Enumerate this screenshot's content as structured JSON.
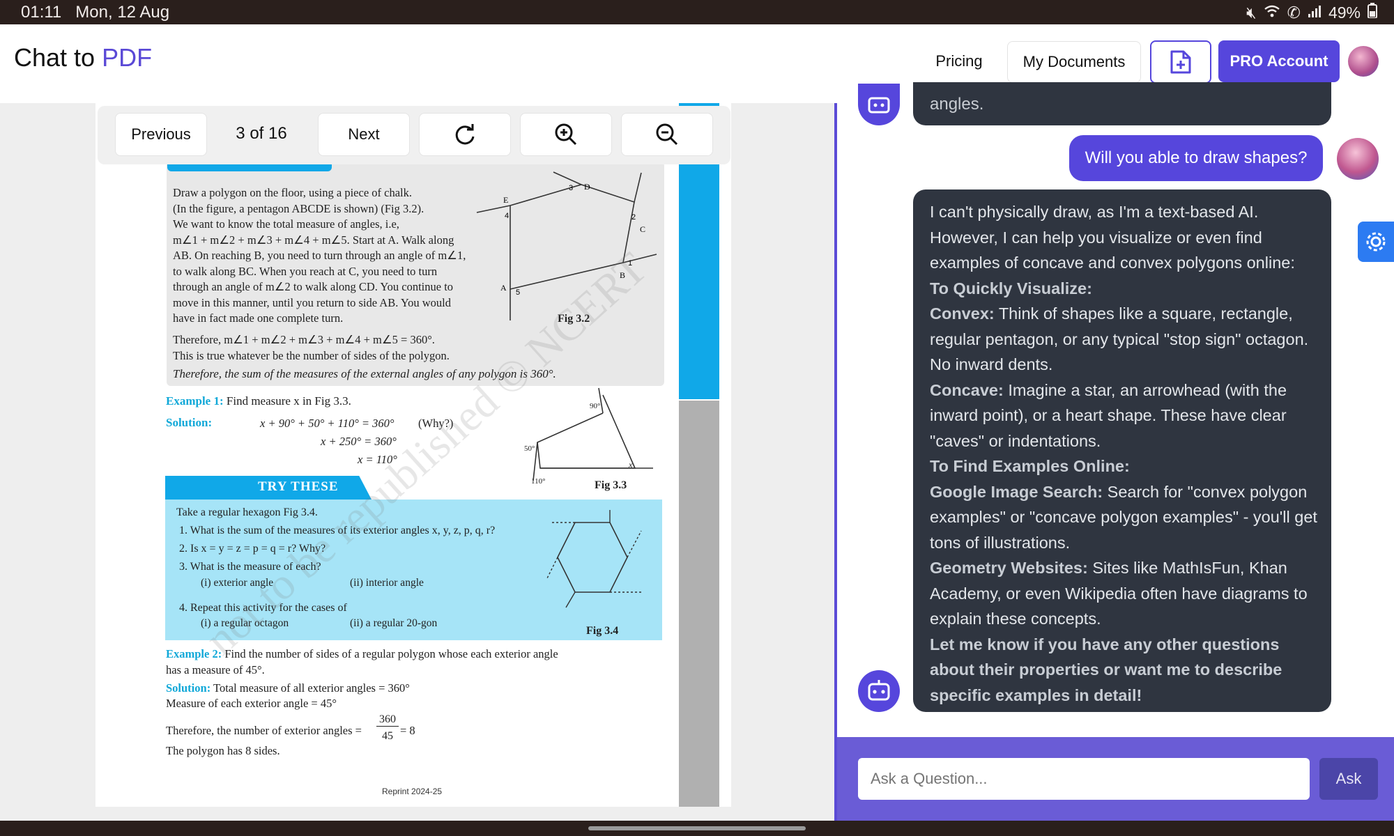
{
  "status": {
    "time": "01:11",
    "date": "Mon, 12 Aug",
    "battery": "49%"
  },
  "header": {
    "brand_prefix": "Chat to",
    "brand_accent": "PDF",
    "pricing": "Pricing",
    "my_documents": "My Documents",
    "pro_account": "PRO Account"
  },
  "pdf_toolbar": {
    "previous": "Previous",
    "page_indicator": "3 of 16",
    "next": "Next"
  },
  "pdf_content": {
    "intro_lines": [
      "Draw a polygon on the floor, using a piece of chalk.",
      "(In the figure, a pentagon ABCDE is shown) (Fig 3.2).",
      "We want to know the total measure of angles, i.e,",
      "m∠1 + m∠2 + m∠3 + m∠4 + m∠5. Start at A. Walk along",
      "AB. On reaching B, you need to turn through an angle of m∠1,",
      "to walk along BC. When you reach at C, you need to turn",
      "through an angle of m∠2 to walk along CD. You continue to",
      "move in this manner, until you return to side AB. You would",
      "have in fact made one complete turn."
    ],
    "therefore_1": "Therefore, m∠1 + m∠2 + m∠3 + m∠4 + m∠5 = 360°.",
    "true_whatever": "This is true whatever be the number of sides of the polygon.",
    "therefore_2": "Therefore, the sum of the measures of the external angles of any polygon is 360°.",
    "fig32": "Fig 3.2",
    "example1_label": "Example 1:",
    "example1_text": "Find measure x in Fig 3.3.",
    "solution_label": "Solution:",
    "sol1_line1": "x + 90° + 50° + 110° = 360°",
    "sol1_why": "(Why?)",
    "sol1_line2": "x + 250° = 360°",
    "sol1_line3": "x = 110°",
    "fig33": "Fig 3.3",
    "fig33_a": "90°",
    "fig33_b": "50°",
    "fig33_c": "110°",
    "fig33_x": "x",
    "try_these": "TRY THESE",
    "try_intro": "Take a regular hexagon Fig 3.4.",
    "try_q1": "1.   What is the sum of the measures of its exterior angles x, y, z, p, q, r?",
    "try_q2": "2.   Is x = y = z = p = q = r? Why?",
    "try_q3": "3.   What is the measure of each?",
    "try_q3_i": "(i)   exterior angle",
    "try_q3_ii": "(ii)   interior angle",
    "try_q4": "4.   Repeat this activity for the cases of",
    "try_q4_i": "(i)   a regular octagon",
    "try_q4_ii": "(ii)   a regular 20-gon",
    "fig34": "Fig 3.4",
    "example2_label": "Example 2:",
    "example2_text": "Find the number of sides of a regular polygon whose each exterior angle",
    "example2_text2": "has a measure of 45°.",
    "solution2_label": "Solution:",
    "sol2_line1": "Total measure of all exterior angles = 360°",
    "sol2_line2": "Measure of each exterior angle = 45°",
    "sol2_line3": "Therefore, the number of exterior angles =",
    "frac_num": "360",
    "frac_den": "45",
    "frac_result": "= 8",
    "sol2_line4": "The polygon has 8 sides.",
    "reprint": "Reprint 2024-25",
    "watermark": "not to be republished © NCERT"
  },
  "chat": {
    "prev_tail": "angles.",
    "user_message": "Will you able to draw shapes?",
    "ai_response": [
      {
        "bold": "",
        "text": "I can't physically draw, as I'm a text-based AI. However, I can help you visualize or even find examples of concave and convex polygons online:"
      },
      {
        "bold": "To Quickly Visualize:",
        "text": ""
      },
      {
        "bold": "Convex:",
        "text": " Think of shapes like a square, rectangle, regular pentagon, or any typical \"stop sign\" octagon. No inward dents."
      },
      {
        "bold": "Concave:",
        "text": " Imagine a star, an arrowhead (with the inward point), or a heart shape. These have clear \"caves\" or indentations."
      },
      {
        "bold": "To Find Examples Online:",
        "text": ""
      },
      {
        "bold": "Google Image Search:",
        "text": " Search for \"convex polygon examples\" or \"concave polygon examples\" - you'll get tons of illustrations."
      },
      {
        "bold": "Geometry Websites:",
        "text": " Sites like MathIsFun, Khan Academy, or even Wikipedia often have diagrams to explain these concepts."
      },
      {
        "bold": "Let me know if you have any other questions about their properties or want me to describe specific examples in detail!",
        "text": ""
      }
    ],
    "input_placeholder": "Ask a Question...",
    "ask_button": "Ask"
  },
  "colors": {
    "accent": "#5646dc",
    "ai_bubble": "#2f3540",
    "cyan": "#10a8d8",
    "try_bg": "#a6e4f7"
  },
  "icons": [
    "mute-icon",
    "wifi-icon",
    "call-icon",
    "signal-icon",
    "battery-icon",
    "new-document-icon",
    "avatar",
    "refresh-icon",
    "zoom-in-icon",
    "zoom-out-icon",
    "bot-icon",
    "settings-icon"
  ]
}
